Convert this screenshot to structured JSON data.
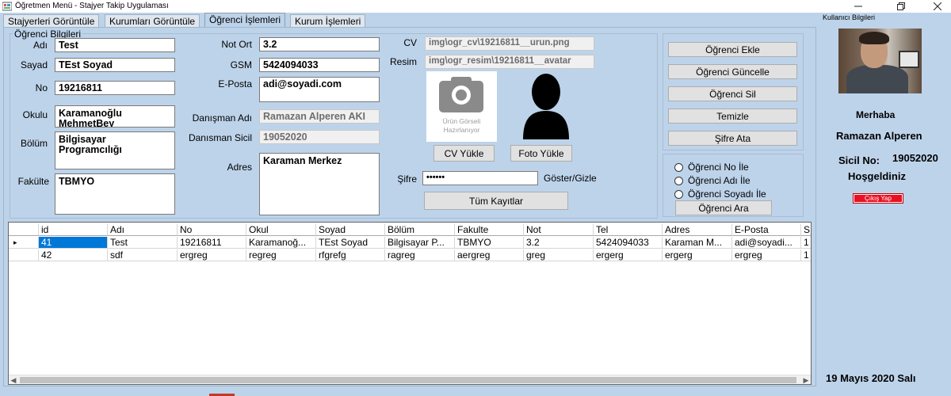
{
  "window": {
    "title": "Öğretmen Menü - Stajyer Takip Uygulaması",
    "minimize_icon": "minimize-icon",
    "restore_icon": "restore-icon",
    "close_icon": "close-icon"
  },
  "tabs": [
    {
      "label": "Stajyerleri Görüntüle",
      "active": false
    },
    {
      "label": "Kurumları Görüntüle",
      "active": false
    },
    {
      "label": "Öğrenci İşlemleri",
      "active": true
    },
    {
      "label": "Kurum İşlemleri",
      "active": false
    }
  ],
  "form": {
    "group_title": "Öğrenci Bilgileri",
    "ad_label": "Adı",
    "ad_value": "Test",
    "soyad_label": "Sayad",
    "soyad_value": "TEst Soyad",
    "no_label": "No",
    "no_value": "19216811",
    "okul_label": "Okulu",
    "okul_value": "Karamanoğlu MehmetBey",
    "bolum_label": "Bölüm",
    "bolum_value": "Bilgisayar Programcılığı",
    "fakulte_label": "Fakülte",
    "fakulte_value": "TBMYO",
    "notort_label": "Not Ort",
    "notort_value": "3.2",
    "gsm_label": "GSM",
    "gsm_value": "5424094033",
    "eposta_label": "E-Posta",
    "eposta_value": "adi@soyadi.com",
    "danisman_label": "Danışman Adı",
    "danisman_value": "Ramazan Alperen  AKI",
    "sicil_label": "Danısman Sicil",
    "sicil_value": "19052020",
    "adres_label": "Adres",
    "adres_value": "Karaman Merkez",
    "cv_label": "CV",
    "cv_value": "img\\ogr_cv\\19216811__urun.png",
    "resim_label": "Resim",
    "resim_value": "img\\ogr_resim\\19216811__avatar",
    "placeholder_text": "Ürün Görseli Hazırlanıyor",
    "cv_button": "CV Yükle",
    "foto_button": "Foto Yükle",
    "sifre_label": "Şifre",
    "sifre_value": "••••••",
    "goster_label": "Göster/Gizle",
    "tum_kayitlar_button": "Tüm Kayıtlar"
  },
  "actions": {
    "ekle": "Öğrenci Ekle",
    "guncelle": "Öğrenci Güncelle",
    "sil": "Öğrenci Sil",
    "temizle": "Temizle",
    "sifre_ata": "Şifre Ata"
  },
  "search": {
    "options": [
      "Öğrenci No İle",
      "Öğrenci Adı İle",
      "Öğrenci Soyadı İle"
    ],
    "button": "Öğrenci Ara"
  },
  "grid": {
    "columns": [
      "id",
      "Adı",
      "No",
      "Okul",
      "Soyad",
      "Bölüm",
      "Fakulte",
      "Not",
      "Tel",
      "Adres",
      "E-Posta",
      "S"
    ],
    "rows": [
      [
        "41",
        "Test",
        "19216811",
        "Karamanoğ...",
        "TEst Soyad",
        "Bilgisayar P...",
        "TBMYO",
        "3.2",
        "5424094033",
        "Karaman M...",
        "adi@soyadi...",
        "1"
      ],
      [
        "42",
        "sdf",
        "ergreg",
        "regreg",
        "rfgrefg",
        "ragreg",
        "aergreg",
        "greg",
        "ergerg",
        "ergerg",
        "ergreg",
        "1"
      ]
    ],
    "current_row_marker": "▸"
  },
  "sidebar": {
    "title": "Kullanıcı Bilgileri",
    "greeting": "Merhaba",
    "user_name": "Ramazan Alperen",
    "sicil_label": "Sicil No:",
    "sicil_value": "19052020",
    "welcome": "Hoşgeldiniz",
    "logout": "Çıkış Yap",
    "date": "19 Mayıs 2020 Salı"
  },
  "colors": {
    "background": "#bdd3ea",
    "selection": "#0078d7",
    "logout": "#e81123"
  }
}
